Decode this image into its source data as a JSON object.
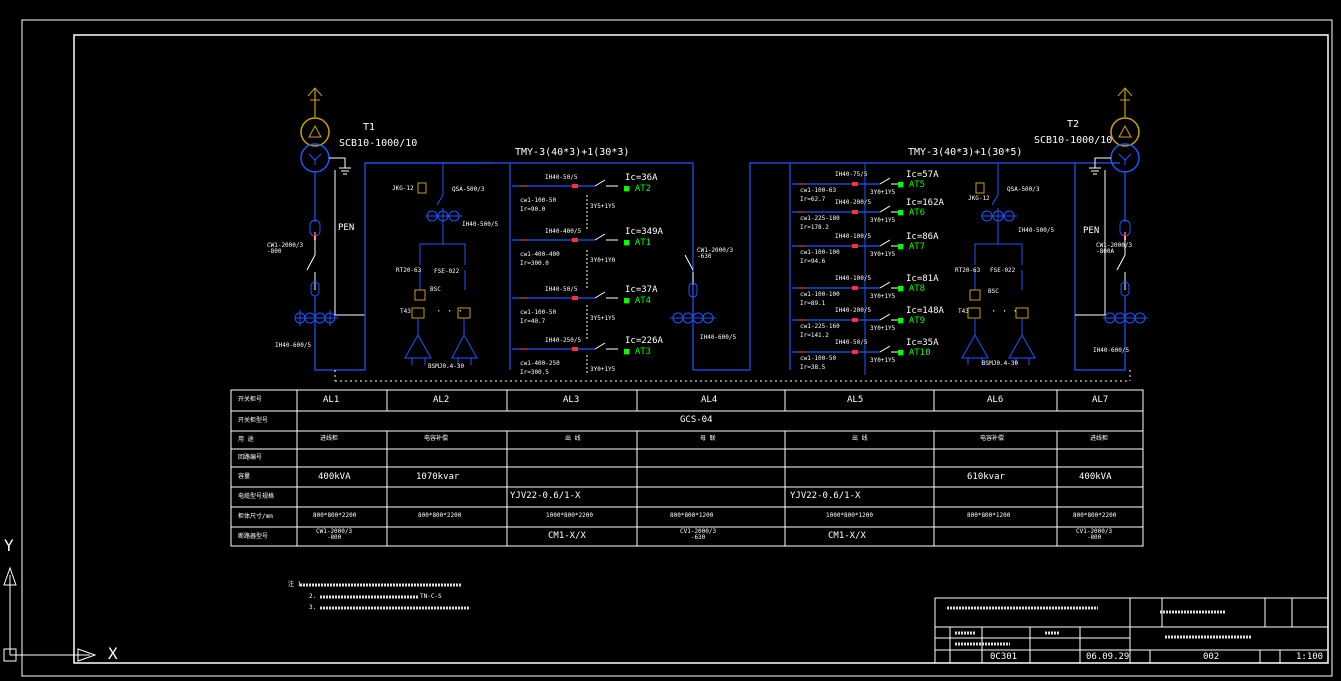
{
  "transformers": {
    "left": {
      "name": "T1",
      "model": "SCB10-1000/10"
    },
    "right": {
      "name": "T2",
      "model": "SCB10-1000/10"
    }
  },
  "busbars": {
    "left": "TMY-3(40*3)+1(30*3)",
    "right": "TMY-3(40*3)+1(30*5)"
  },
  "pen_label": "PEN",
  "breakers": {
    "main_left": "CW1-2000/3\n-800",
    "main_right": "CW1-2000/3\n-800A",
    "tie": "CW1-2000/3\n-630",
    "ct_left": "IH40-600/5",
    "ct_right": "IH40-600/5",
    "ct_tie": "IH40-600/5"
  },
  "capacitor_panels": {
    "left": {
      "name": "BSMJ0.4-30",
      "sw": "JKG-12",
      "fuse": "QSA-500/3",
      "ct": "IH40-500/5",
      "rt": "RT20-63",
      "fse": "FSE-022",
      "sc": "BSC",
      "t": "T43"
    },
    "right": {
      "name": "BSMJ0.4-30",
      "sw": "JKG-12",
      "fuse": "QSA-500/3",
      "ct": "IH40-500/5",
      "rt": "RT20-63",
      "fse": "FSE-022",
      "sc": "BSC",
      "t": "T43"
    }
  },
  "feeders_left": [
    {
      "ct": "IH40-50/5",
      "brk": "cw1-100-50",
      "ir": "Ir=90.0",
      "load": "Ic=36A",
      "at": "AT2",
      "cable": "3Y5+1Y5"
    },
    {
      "ct": "IH40-400/5",
      "brk": "cw1-400-400",
      "ir": "Ir=300.0",
      "load": "Ic=349A",
      "at": "AT1",
      "cable": "3Y0+1Y0"
    },
    {
      "ct": "IH40-50/5",
      "brk": "cw1-100-50",
      "ir": "Ir=40.7",
      "load": "Ic=37A",
      "at": "AT4",
      "cable": "3Y5+1Y5"
    },
    {
      "ct": "IH40-250/5",
      "brk": "cw1-400-250",
      "ir": "Ir=300.5",
      "load": "Ic=226A",
      "at": "AT3",
      "cable": "3Y0+1Y5"
    }
  ],
  "feeders_right": [
    {
      "ct": "IH40-75/5",
      "brk": "cw1-100-63",
      "ir": "Ir=62.7",
      "load": "Ic=57A",
      "at": "AT5",
      "cable": "3Y0+1Y5"
    },
    {
      "ct": "IH40-200/5",
      "brk": "cw1-225-180",
      "ir": "Ir=178.2",
      "load": "Ic=162A",
      "at": "AT6",
      "cable": "3Y0+1Y5"
    },
    {
      "ct": "IH40-100/5",
      "brk": "cw1-100-100",
      "ir": "Ir=94.6",
      "load": "Ic=86A",
      "at": "AT7",
      "cable": "3Y0+1Y5"
    },
    {
      "ct": "IH40-100/5",
      "brk": "cw1-100-100",
      "ir": "Ir=89.1",
      "load": "Ic=81A",
      "at": "AT8",
      "cable": "3Y0+1Y5"
    },
    {
      "ct": "IH40-200/5",
      "brk": "cw1-225-160",
      "ir": "Ir=141.2",
      "load": "Ic=148A",
      "at": "AT9",
      "cable": "3Y0+1Y5"
    },
    {
      "ct": "IH40-50/5",
      "brk": "cw1-100-50",
      "ir": "Ir=38.5",
      "load": "Ic=35A",
      "at": "AT10",
      "cable": "3Y0+1Y5"
    }
  ],
  "table": {
    "cols": [
      "AL1",
      "AL2",
      "AL3",
      "AL4",
      "AL5",
      "AL6",
      "AL7"
    ],
    "model": "GCS-04",
    "capacity": {
      "AL1": "400kVA",
      "AL2": "1070kvar",
      "AL6": "610kvar",
      "AL7": "400kVA"
    },
    "cable_left": "YJV22-0.6/1-X",
    "cable_right": "YJV22-0.6/1-X",
    "size": {
      "AL1": "800*800*2200",
      "AL2": "800*800*2200",
      "AL3": "1000*800*2200",
      "AL4": "800*800*1200",
      "AL5": "1000*800*1200",
      "AL6": "800*800*1200",
      "AL7": "800*800*2200"
    },
    "brk": {
      "AL1": "CW1-2000/3\n-800",
      "AL3": "CM1-X/X",
      "AL4": "CV1-2000/3\n-630",
      "AL5": "CM1-X/X",
      "AL7": "CV1-2000/3\n-800"
    }
  },
  "notes": {
    "n1": "注 1.",
    "n2": "2.",
    "n3": "3.",
    "n2_tail": "TN-C-S"
  },
  "title_block": {
    "date": "06.09.29",
    "drawing_no": "0C301",
    "sheet": "002",
    "scale": "1:100"
  },
  "ucs": {
    "y": "Y",
    "x": "X"
  }
}
